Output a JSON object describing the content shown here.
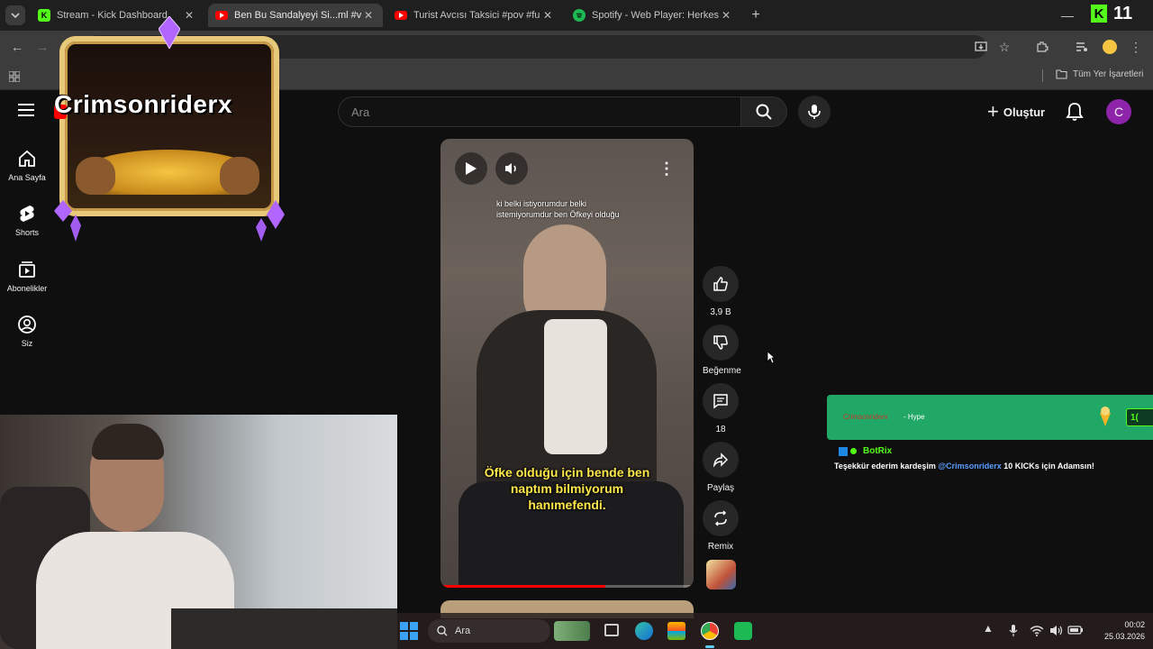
{
  "tabs": [
    {
      "title": "Stream - Kick Dashboard",
      "favicon": "kick-icon",
      "color": "#53fc18"
    },
    {
      "title": "Ben Bu Sandalyeyi Si...ml #vart",
      "favicon": "youtube-icon",
      "color": "#ff0000"
    },
    {
      "title": "Turist Avcısı Taksici #pov #funn",
      "favicon": "youtube-icon",
      "color": "#ff0000"
    },
    {
      "title": "Spotify - Web Player: Herkes İç",
      "favicon": "spotify-icon",
      "color": "#1db954"
    }
  ],
  "window": {
    "clock_partial": "11"
  },
  "bookmarks": {
    "all_bookmarks_label": "Tüm Yer İşaretleri"
  },
  "youtube": {
    "search_placeholder": "Ara",
    "create_label": "Oluştur",
    "avatar_letter": "C",
    "sidebar": [
      {
        "label": "Ana Sayfa",
        "icon": "home-icon"
      },
      {
        "label": "Shorts",
        "icon": "shorts-icon"
      },
      {
        "label": "Abonelikler",
        "icon": "subscriptions-icon"
      },
      {
        "label": "Siz",
        "icon": "account-icon"
      }
    ],
    "short": {
      "subtitle_top_1": "ki belki istiyorumdur belki",
      "subtitle_top_2": "istemiyorumdur ben Öfkeyi olduğu",
      "subtitle_bottom_1": "Öfke olduğu için bende ben",
      "subtitle_bottom_2": "naptım bilmiyorum",
      "subtitle_bottom_3": "hanımefendi.",
      "progress": 0.65
    },
    "actions": {
      "like_count": "3,9 B",
      "dislike_label": "Beğenme",
      "comment_count": "18",
      "share_label": "Paylaş",
      "remix_label": "Remix"
    }
  },
  "overlay": {
    "stream_name": "Crimsonriderx",
    "hype_user": "Crimsonriderx",
    "hype_label": "- Hype",
    "hype_amount_partial": "1(",
    "bot_name": "BotRix",
    "chat_message_prefix": "Teşekkür ederim kardeşim ",
    "chat_mention": "@Crimsonriderx",
    "chat_message_suffix": " 10 KICKs için Adamsın!"
  },
  "taskbar": {
    "search_label": "Ara",
    "time": "00:02",
    "date": "25.03.2026"
  }
}
